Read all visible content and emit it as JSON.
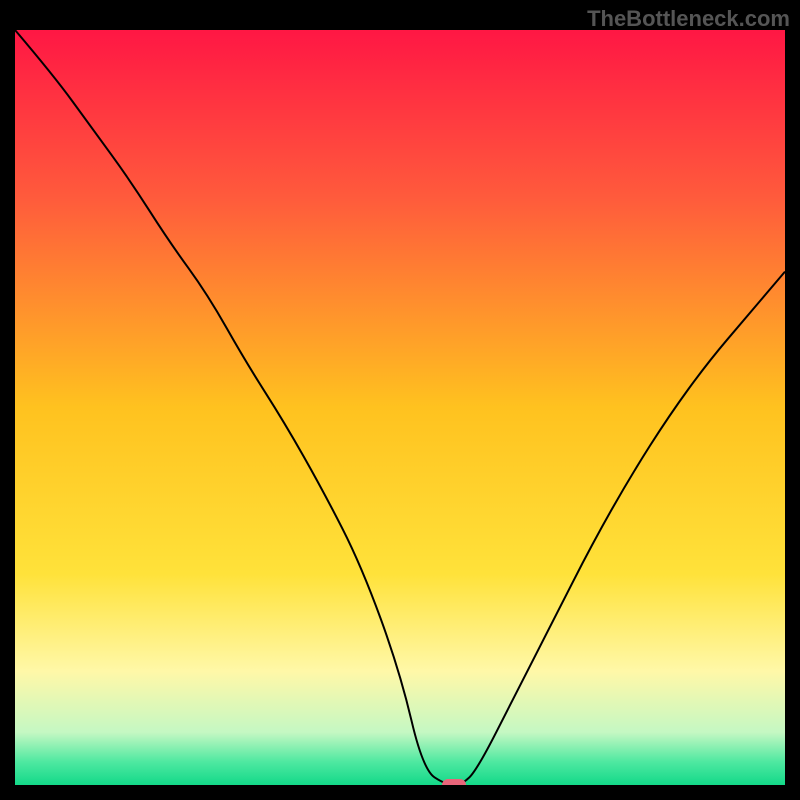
{
  "watermark": "TheBottleneck.com",
  "chart_data": {
    "type": "line",
    "title": "",
    "xlabel": "",
    "ylabel": "",
    "xlim": [
      0,
      100
    ],
    "ylim": [
      0,
      100
    ],
    "x": [
      0,
      5,
      10,
      15,
      20,
      25,
      30,
      35,
      40,
      45,
      50,
      53,
      56,
      58,
      60,
      65,
      70,
      75,
      80,
      85,
      90,
      95,
      100
    ],
    "values": [
      100,
      94,
      87,
      80,
      72,
      65,
      56,
      48,
      39,
      29,
      15,
      2,
      0,
      0,
      2,
      12,
      22,
      32,
      41,
      49,
      56,
      62,
      68
    ],
    "marker": {
      "x": 57,
      "y": 0
    },
    "gradient_stops": [
      {
        "offset": 0,
        "color": "#ff1744"
      },
      {
        "offset": 22,
        "color": "#ff5a3c"
      },
      {
        "offset": 50,
        "color": "#ffc21f"
      },
      {
        "offset": 72,
        "color": "#ffe23a"
      },
      {
        "offset": 85,
        "color": "#fff8a8"
      },
      {
        "offset": 93,
        "color": "#c5f8c3"
      },
      {
        "offset": 97,
        "color": "#4de8a0"
      },
      {
        "offset": 100,
        "color": "#13d989"
      }
    ]
  }
}
